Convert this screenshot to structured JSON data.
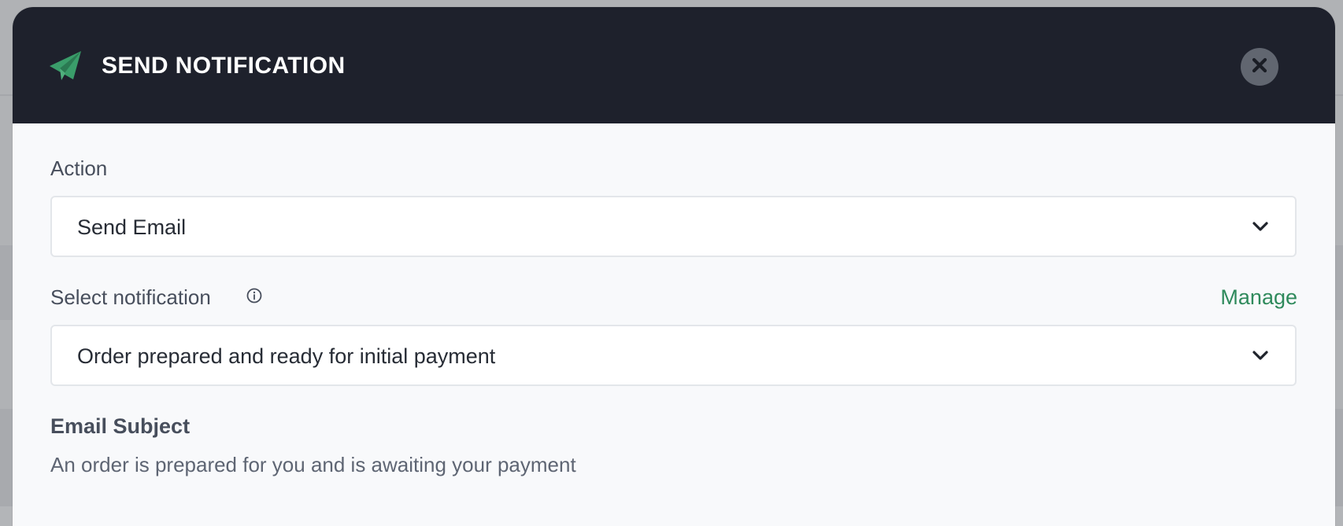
{
  "modal": {
    "title": "SEND NOTIFICATION",
    "icon": "paper-plane-icon",
    "close_icon": "close-icon",
    "accent_color": "#3a9d6a",
    "header_color": "#1e212c"
  },
  "action": {
    "label": "Action",
    "value": "Send Email"
  },
  "notification": {
    "label": "Select notification",
    "info_icon": "info-icon",
    "manage_label": "Manage",
    "value": "Order prepared and ready for initial payment"
  },
  "email": {
    "subject_label": "Email Subject",
    "subject_value": "An order is prepared for you and is awaiting your payment"
  }
}
